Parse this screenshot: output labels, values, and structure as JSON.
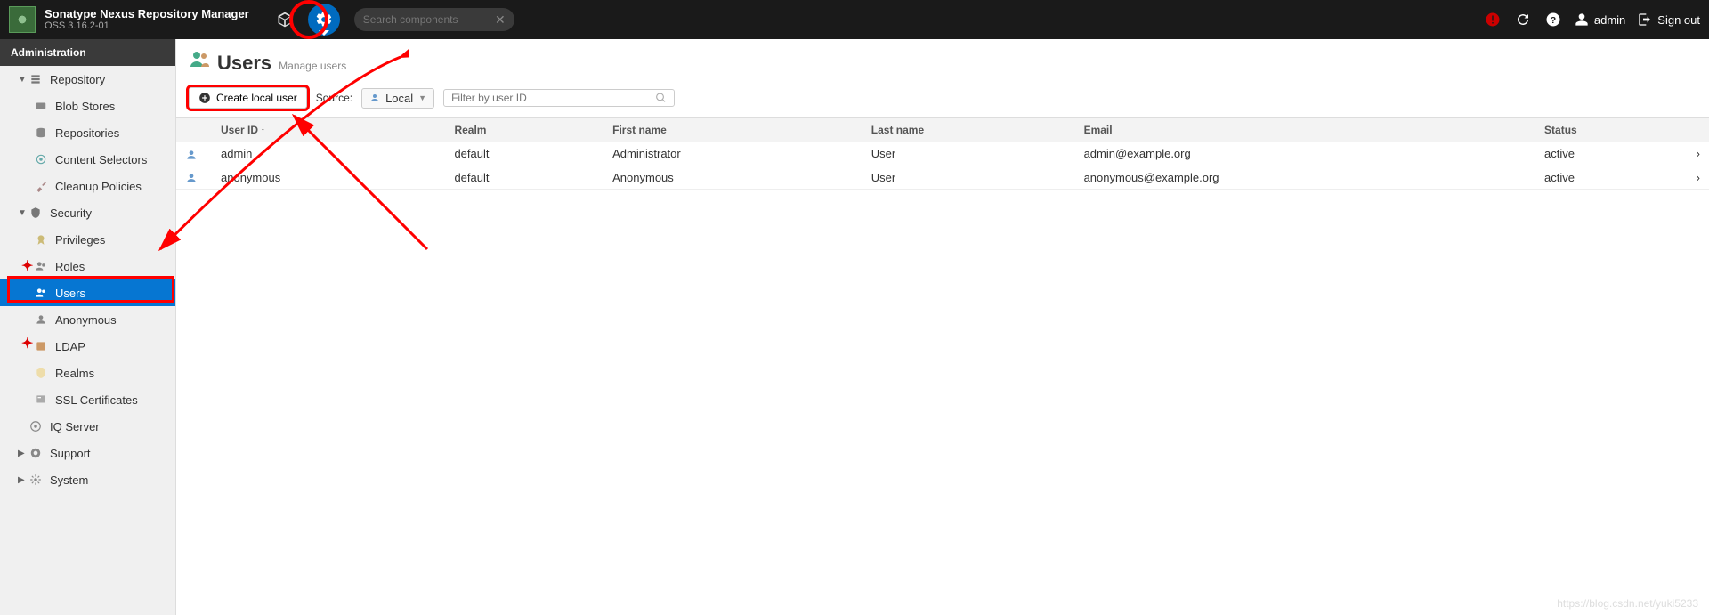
{
  "header": {
    "brand_title": "Sonatype Nexus Repository Manager",
    "brand_sub": "OSS 3.16.2-01",
    "search_placeholder": "Search components",
    "username": "admin",
    "signout": "Sign out"
  },
  "sidebar": {
    "title": "Administration",
    "groups": [
      {
        "label": "Repository",
        "expanded": true,
        "items": [
          {
            "label": "Blob Stores",
            "icon": "blob"
          },
          {
            "label": "Repositories",
            "icon": "db"
          },
          {
            "label": "Content Selectors",
            "icon": "selector"
          },
          {
            "label": "Cleanup Policies",
            "icon": "broom"
          }
        ]
      },
      {
        "label": "Security",
        "expanded": true,
        "items": [
          {
            "label": "Privileges",
            "icon": "badge"
          },
          {
            "label": "Roles",
            "icon": "roles"
          },
          {
            "label": "Users",
            "icon": "users",
            "selected": true
          },
          {
            "label": "Anonymous",
            "icon": "anon"
          },
          {
            "label": "LDAP",
            "icon": "ldap"
          },
          {
            "label": "Realms",
            "icon": "shield"
          },
          {
            "label": "SSL Certificates",
            "icon": "cert"
          }
        ]
      },
      {
        "label": "IQ Server",
        "expanded": false,
        "items": []
      },
      {
        "label": "Support",
        "expanded": false,
        "items": []
      },
      {
        "label": "System",
        "expanded": false,
        "items": []
      }
    ]
  },
  "page": {
    "title": "Users",
    "subtitle": "Manage users",
    "create_label": "Create local user",
    "source_label": "Source:",
    "source_value": "Local",
    "filter_placeholder": "Filter by user ID"
  },
  "table": {
    "columns": [
      "User ID",
      "Realm",
      "First name",
      "Last name",
      "Email",
      "Status"
    ],
    "rows": [
      {
        "user_id": "admin",
        "realm": "default",
        "first_name": "Administrator",
        "last_name": "User",
        "email": "admin@example.org",
        "status": "active"
      },
      {
        "user_id": "anonymous",
        "realm": "default",
        "first_name": "Anonymous",
        "last_name": "User",
        "email": "anonymous@example.org",
        "status": "active"
      }
    ]
  },
  "watermark": "https://blog.csdn.net/yuki5233"
}
